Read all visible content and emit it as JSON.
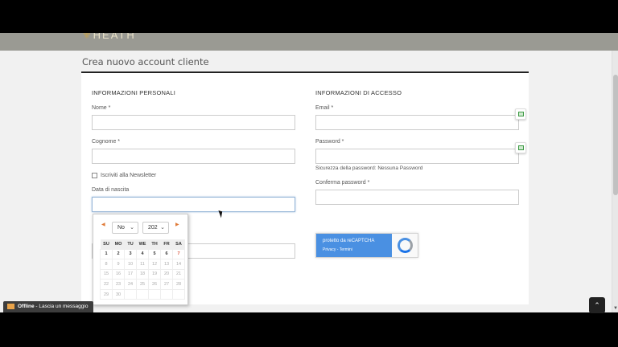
{
  "header": {
    "logo_text": "HEATH"
  },
  "page": {
    "title": "Crea nuovo account cliente"
  },
  "personal": {
    "section_title": "INFORMAZIONI PERSONALI",
    "first_name_label": "Nome *",
    "last_name_label": "Cognome *",
    "newsletter_label": "Iscriviti alla Newsletter",
    "dob_label": "Data di nascita"
  },
  "access": {
    "section_title": "INFORMAZIONI DI ACCESSO",
    "email_label": "Email *",
    "password_label": "Password *",
    "strength_text": "Sicurezza della password: Nessuna Password",
    "confirm_label": "Conferma password *"
  },
  "recaptcha": {
    "line1": "protetto da reCAPTCHA",
    "line2": "Privacy - Termini"
  },
  "datepicker": {
    "month_selected": "No",
    "year_selected": "202",
    "weekdays": [
      "SU",
      "MO",
      "TU",
      "WE",
      "TH",
      "FR",
      "SA"
    ],
    "weeks": [
      [
        "",
        "1",
        "2",
        "3",
        "4",
        "5",
        "6",
        "7"
      ],
      [
        "8",
        "9",
        "10",
        "11",
        "12",
        "13",
        "14"
      ],
      [
        "15",
        "16",
        "17",
        "18",
        "19",
        "20",
        "21"
      ],
      [
        "22",
        "23",
        "24",
        "25",
        "26",
        "27",
        "28"
      ],
      [
        "29",
        "30",
        "",
        "",
        "",
        "",
        ""
      ]
    ],
    "today": "7"
  },
  "chat": {
    "status": "Offline",
    "message": " - Lascia un messaggio"
  },
  "scroll_top_icon": "chevron-up-icon"
}
